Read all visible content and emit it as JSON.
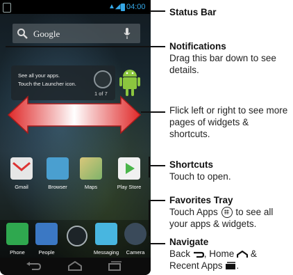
{
  "status_bar": {
    "time": "04:00"
  },
  "search": {
    "label": "Google"
  },
  "hint": {
    "line1": "See all your apps.",
    "line2": "Touch the Launcher icon.",
    "page_indicator": "1 of 7"
  },
  "shortcuts": [
    {
      "label": "Gmail",
      "icon": "gmail-icon",
      "color": "#e6e6e6"
    },
    {
      "label": "Browser",
      "icon": "browser-icon",
      "color": "#4a9fd0"
    },
    {
      "label": "Maps",
      "icon": "maps-icon",
      "color": "#d9c77a"
    },
    {
      "label": "Play Store",
      "icon": "play-store-icon",
      "color": "#f1f1f1"
    }
  ],
  "favorites": [
    {
      "label": "Phone",
      "icon": "phone-icon",
      "color": "#2fa84f"
    },
    {
      "label": "People",
      "icon": "people-icon",
      "color": "#3b78c4"
    },
    {
      "label": "Messaging",
      "icon": "messaging-icon",
      "color": "#48b6e0"
    },
    {
      "label": "Camera",
      "icon": "camera-icon",
      "color": "#3a4a5a"
    }
  ],
  "annotations": {
    "status_bar": {
      "title": "Status Bar"
    },
    "notifications": {
      "title": "Notifications",
      "body": "Drag this bar down to see details."
    },
    "flick": {
      "body": "Flick left or right to see more pages of widgets & shortcuts."
    },
    "shortcuts": {
      "title": "Shortcuts",
      "body": "Touch to open."
    },
    "favorites_tray": {
      "title": "Favorites Tray",
      "body_before": "Touch Apps",
      "body_after": "to see all your apps & widgets."
    },
    "navigate": {
      "title": "Navigate",
      "back": "Back",
      "home": ", Home",
      "amp": "&",
      "recent": "Recent Apps"
    }
  },
  "colors": {
    "accent": "#35a7e6",
    "arrow_red": "#e02a2a"
  }
}
